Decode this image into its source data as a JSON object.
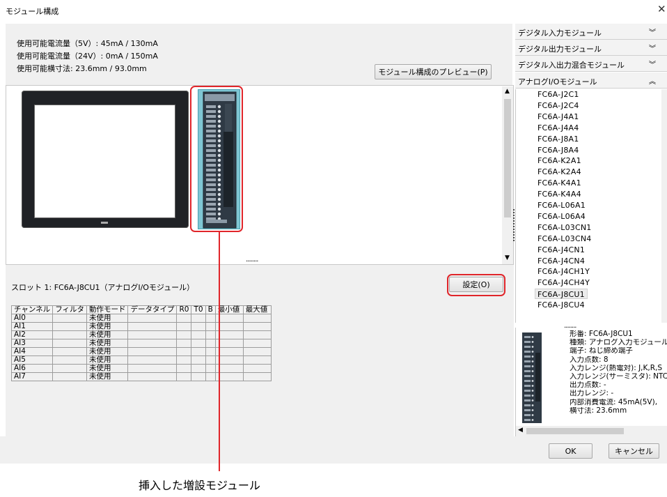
{
  "window": {
    "title": "モジュール構成"
  },
  "info": {
    "current_5v": "使用可能電流量（5V）: 45mA / 130mA",
    "current_24v": "使用可能電流量（24V）: 0mA / 150mA",
    "width": "使用可能横寸法: 23.6mm / 93.0mm"
  },
  "buttons": {
    "preview": "モジュール構成のプレビュー(P)",
    "settings": "設定(O)",
    "ok": "OK",
    "cancel": "キャンセル"
  },
  "splitter_dots": "........",
  "slot": {
    "label": "スロット 1: FC6A-J8CU1（アナログI/Oモジュール）"
  },
  "channel_table": {
    "headers": [
      "チャンネル",
      "フィルタ",
      "動作モード",
      "データタイプ",
      "R0",
      "T0",
      "B",
      "最小値",
      "最大値"
    ],
    "rows": [
      [
        "AI0",
        "",
        "未使用",
        "",
        "",
        "",
        "",
        "",
        ""
      ],
      [
        "AI1",
        "",
        "未使用",
        "",
        "",
        "",
        "",
        "",
        ""
      ],
      [
        "AI2",
        "",
        "未使用",
        "",
        "",
        "",
        "",
        "",
        ""
      ],
      [
        "AI3",
        "",
        "未使用",
        "",
        "",
        "",
        "",
        "",
        ""
      ],
      [
        "AI4",
        "",
        "未使用",
        "",
        "",
        "",
        "",
        "",
        ""
      ],
      [
        "AI5",
        "",
        "未使用",
        "",
        "",
        "",
        "",
        "",
        ""
      ],
      [
        "AI6",
        "",
        "未使用",
        "",
        "",
        "",
        "",
        "",
        ""
      ],
      [
        "AI7",
        "",
        "未使用",
        "",
        "",
        "",
        "",
        "",
        ""
      ]
    ]
  },
  "categories": [
    {
      "label": "デジタル入力モジュール",
      "state": "collapsed"
    },
    {
      "label": "デジタル出力モジュール",
      "state": "collapsed"
    },
    {
      "label": "デジタル入出力混合モジュール",
      "state": "collapsed"
    },
    {
      "label": "アナログI/Oモジュール",
      "state": "expanded"
    }
  ],
  "module_list": [
    "FC6A-J2C1",
    "FC6A-J2C4",
    "FC6A-J4A1",
    "FC6A-J4A4",
    "FC6A-J8A1",
    "FC6A-J8A4",
    "FC6A-K2A1",
    "FC6A-K2A4",
    "FC6A-K4A1",
    "FC6A-K4A4",
    "FC6A-L06A1",
    "FC6A-L06A4",
    "FC6A-L03CN1",
    "FC6A-L03CN4",
    "FC6A-J4CN1",
    "FC6A-J4CN4",
    "FC6A-J4CH1Y",
    "FC6A-J4CH4Y",
    "FC6A-J8CU1",
    "FC6A-J8CU4"
  ],
  "selected_module": "FC6A-J8CU1",
  "properties": [
    "形番: FC6A-J8CU1",
    "種類: アナログ入力モジュール",
    "端子: ねじ締め端子",
    "入力点数: 8",
    "入力レンジ(熱電対): J,K,R,S",
    "入力レンジ(サーミスタ): NTC,",
    "出力点数: -",
    "出力レンジ: -",
    "内部消費電流: 45mA(5V),",
    "横寸法: 23.6mm"
  ],
  "annotation": "挿入した増設モジュール",
  "colors": {
    "highlight": "#e0252a",
    "module_body": "#2f3a45",
    "module_selected_bg": "#7fc6d3"
  }
}
